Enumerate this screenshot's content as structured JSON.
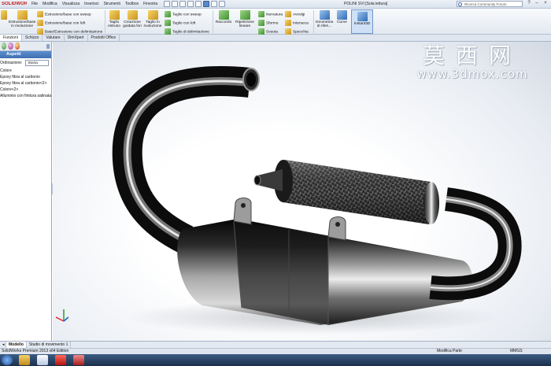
{
  "app": {
    "logo": "SOLIDWORKS",
    "doc_title": "POLINI SVI [Sola lettura]",
    "search_placeholder": "Ricerca Community Forum"
  },
  "menu": [
    "File",
    "Modifica",
    "Visualizza",
    "Inserisci",
    "Strumenti",
    "Toolbox",
    "Finestra"
  ],
  "ribbon": {
    "sweep_boss": "Estrusione/base con sweep",
    "revolve_boss": "Estrusione/base in rivoluzione",
    "loft_boss": "Estrusione/base con loft",
    "boundary_boss": "Base/Estrusione con delimitazione",
    "cut_extrude": "Taglio estruso",
    "hole_wizard": "Creazione guidata fori",
    "cut_revolve": "Taglio in rivoluzione",
    "cut_sweep": "Taglio con sweep",
    "cut_loft": "Taglio con loft",
    "cut_boundary": "Taglio di delimitazione",
    "fillet": "Raccordo",
    "linear_pattern": "Ripetizione lineare",
    "rib": "Nervatura",
    "draft": "Sformo",
    "shell": "Svuota",
    "wrap": "Avvolgi",
    "intersect": "Interseca",
    "mirror": "Specchia",
    "reference_geometry": "Geometria di riferi...",
    "curves": "Curve",
    "instant3d": "Instant3D"
  },
  "tabs": [
    "Funzioni",
    "Schizzo",
    "Valutare",
    "DimXpert",
    "Prodotti Office"
  ],
  "panel": {
    "title": "Aspetti",
    "filter_label": "Ordinazione:",
    "filter_value": "Storia",
    "appearances": [
      "Colore",
      "Epoxy fibra al carbonio",
      "Epoxy fibra al carbonio<2>",
      "Colore<2>",
      "Alluminio con finitura satinata"
    ]
  },
  "watermark": {
    "chinese": "莫西网",
    "url": "www.3dmox.com"
  },
  "bottom_tabs": [
    "Modello",
    "Studio di movimento 1"
  ],
  "status": {
    "edition": "SolidWorks Premium 2013 x64 Edition",
    "mode": "Modifica Parte",
    "units": "MMGS"
  }
}
